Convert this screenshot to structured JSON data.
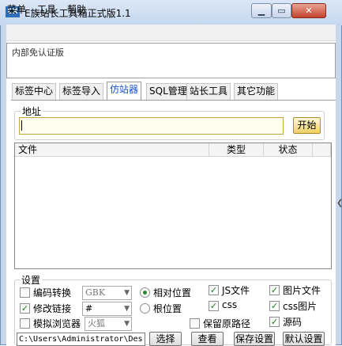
{
  "window": {
    "title": "E族站长工具箱正式版1.1",
    "icon_text": "EX"
  },
  "menu": [
    "菜单",
    "工具",
    "帮助"
  ],
  "notice": "内部免认证版",
  "tabs": [
    "标签中心",
    "标签导入",
    "仿站器",
    "SQL管理",
    "站长工具",
    "其它功能"
  ],
  "active_tab": "仿站器",
  "address": {
    "legend": "地址",
    "value": "",
    "start_label": "开始"
  },
  "list": {
    "columns": [
      "文件",
      "类型",
      "状态",
      ""
    ]
  },
  "settings": {
    "legend": "设置",
    "encode": {
      "label": "编码转换",
      "checked": false,
      "value": "GBK"
    },
    "modify_link": {
      "label": "修改链接",
      "checked": true,
      "value": "#"
    },
    "browser": {
      "label": "模拟浏览器",
      "checked": false,
      "value": "火狐"
    },
    "relative": {
      "label": "相对位置",
      "selected": true
    },
    "root": {
      "label": "根位置",
      "selected": false
    },
    "keep_path": {
      "label": "保留原路径",
      "checked": false
    },
    "js": {
      "label": "JS文件",
      "checked": true
    },
    "css": {
      "label": "css",
      "checked": true
    },
    "images": {
      "label": "图片文件",
      "checked": true
    },
    "css_images": {
      "label": "css图片",
      "checked": true
    },
    "source": {
      "label": "源码",
      "checked": true
    },
    "path": "C:\\Users\\Administrator\\Des"
  },
  "buttons": {
    "choose": "选择",
    "view": "查看",
    "save": "保存设置",
    "default": "默认设置"
  }
}
